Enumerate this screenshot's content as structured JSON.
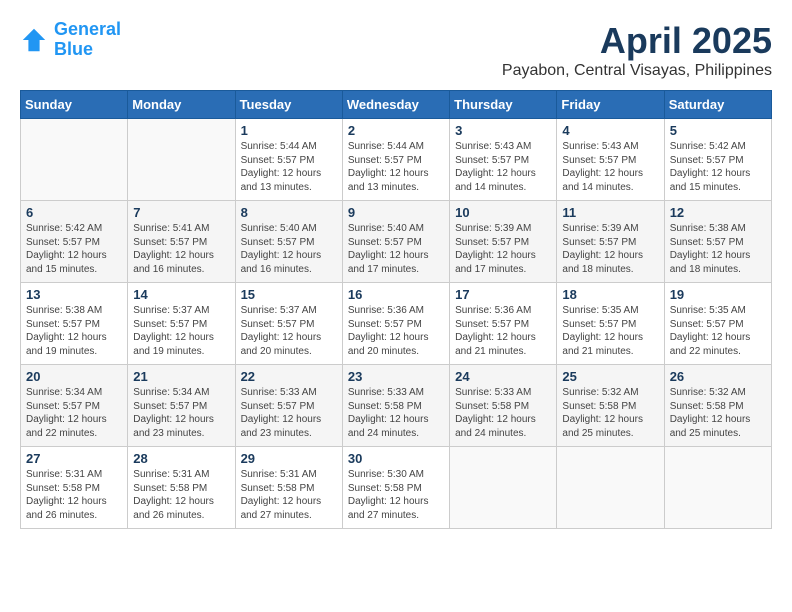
{
  "header": {
    "logo_line1": "General",
    "logo_line2": "Blue",
    "month_year": "April 2025",
    "location": "Payabon, Central Visayas, Philippines"
  },
  "weekdays": [
    "Sunday",
    "Monday",
    "Tuesday",
    "Wednesday",
    "Thursday",
    "Friday",
    "Saturday"
  ],
  "weeks": [
    [
      {
        "day": "",
        "sunrise": "",
        "sunset": "",
        "daylight": ""
      },
      {
        "day": "",
        "sunrise": "",
        "sunset": "",
        "daylight": ""
      },
      {
        "day": "1",
        "sunrise": "Sunrise: 5:44 AM",
        "sunset": "Sunset: 5:57 PM",
        "daylight": "Daylight: 12 hours and 13 minutes."
      },
      {
        "day": "2",
        "sunrise": "Sunrise: 5:44 AM",
        "sunset": "Sunset: 5:57 PM",
        "daylight": "Daylight: 12 hours and 13 minutes."
      },
      {
        "day": "3",
        "sunrise": "Sunrise: 5:43 AM",
        "sunset": "Sunset: 5:57 PM",
        "daylight": "Daylight: 12 hours and 14 minutes."
      },
      {
        "day": "4",
        "sunrise": "Sunrise: 5:43 AM",
        "sunset": "Sunset: 5:57 PM",
        "daylight": "Daylight: 12 hours and 14 minutes."
      },
      {
        "day": "5",
        "sunrise": "Sunrise: 5:42 AM",
        "sunset": "Sunset: 5:57 PM",
        "daylight": "Daylight: 12 hours and 15 minutes."
      }
    ],
    [
      {
        "day": "6",
        "sunrise": "Sunrise: 5:42 AM",
        "sunset": "Sunset: 5:57 PM",
        "daylight": "Daylight: 12 hours and 15 minutes."
      },
      {
        "day": "7",
        "sunrise": "Sunrise: 5:41 AM",
        "sunset": "Sunset: 5:57 PM",
        "daylight": "Daylight: 12 hours and 16 minutes."
      },
      {
        "day": "8",
        "sunrise": "Sunrise: 5:40 AM",
        "sunset": "Sunset: 5:57 PM",
        "daylight": "Daylight: 12 hours and 16 minutes."
      },
      {
        "day": "9",
        "sunrise": "Sunrise: 5:40 AM",
        "sunset": "Sunset: 5:57 PM",
        "daylight": "Daylight: 12 hours and 17 minutes."
      },
      {
        "day": "10",
        "sunrise": "Sunrise: 5:39 AM",
        "sunset": "Sunset: 5:57 PM",
        "daylight": "Daylight: 12 hours and 17 minutes."
      },
      {
        "day": "11",
        "sunrise": "Sunrise: 5:39 AM",
        "sunset": "Sunset: 5:57 PM",
        "daylight": "Daylight: 12 hours and 18 minutes."
      },
      {
        "day": "12",
        "sunrise": "Sunrise: 5:38 AM",
        "sunset": "Sunset: 5:57 PM",
        "daylight": "Daylight: 12 hours and 18 minutes."
      }
    ],
    [
      {
        "day": "13",
        "sunrise": "Sunrise: 5:38 AM",
        "sunset": "Sunset: 5:57 PM",
        "daylight": "Daylight: 12 hours and 19 minutes."
      },
      {
        "day": "14",
        "sunrise": "Sunrise: 5:37 AM",
        "sunset": "Sunset: 5:57 PM",
        "daylight": "Daylight: 12 hours and 19 minutes."
      },
      {
        "day": "15",
        "sunrise": "Sunrise: 5:37 AM",
        "sunset": "Sunset: 5:57 PM",
        "daylight": "Daylight: 12 hours and 20 minutes."
      },
      {
        "day": "16",
        "sunrise": "Sunrise: 5:36 AM",
        "sunset": "Sunset: 5:57 PM",
        "daylight": "Daylight: 12 hours and 20 minutes."
      },
      {
        "day": "17",
        "sunrise": "Sunrise: 5:36 AM",
        "sunset": "Sunset: 5:57 PM",
        "daylight": "Daylight: 12 hours and 21 minutes."
      },
      {
        "day": "18",
        "sunrise": "Sunrise: 5:35 AM",
        "sunset": "Sunset: 5:57 PM",
        "daylight": "Daylight: 12 hours and 21 minutes."
      },
      {
        "day": "19",
        "sunrise": "Sunrise: 5:35 AM",
        "sunset": "Sunset: 5:57 PM",
        "daylight": "Daylight: 12 hours and 22 minutes."
      }
    ],
    [
      {
        "day": "20",
        "sunrise": "Sunrise: 5:34 AM",
        "sunset": "Sunset: 5:57 PM",
        "daylight": "Daylight: 12 hours and 22 minutes."
      },
      {
        "day": "21",
        "sunrise": "Sunrise: 5:34 AM",
        "sunset": "Sunset: 5:57 PM",
        "daylight": "Daylight: 12 hours and 23 minutes."
      },
      {
        "day": "22",
        "sunrise": "Sunrise: 5:33 AM",
        "sunset": "Sunset: 5:57 PM",
        "daylight": "Daylight: 12 hours and 23 minutes."
      },
      {
        "day": "23",
        "sunrise": "Sunrise: 5:33 AM",
        "sunset": "Sunset: 5:58 PM",
        "daylight": "Daylight: 12 hours and 24 minutes."
      },
      {
        "day": "24",
        "sunrise": "Sunrise: 5:33 AM",
        "sunset": "Sunset: 5:58 PM",
        "daylight": "Daylight: 12 hours and 24 minutes."
      },
      {
        "day": "25",
        "sunrise": "Sunrise: 5:32 AM",
        "sunset": "Sunset: 5:58 PM",
        "daylight": "Daylight: 12 hours and 25 minutes."
      },
      {
        "day": "26",
        "sunrise": "Sunrise: 5:32 AM",
        "sunset": "Sunset: 5:58 PM",
        "daylight": "Daylight: 12 hours and 25 minutes."
      }
    ],
    [
      {
        "day": "27",
        "sunrise": "Sunrise: 5:31 AM",
        "sunset": "Sunset: 5:58 PM",
        "daylight": "Daylight: 12 hours and 26 minutes."
      },
      {
        "day": "28",
        "sunrise": "Sunrise: 5:31 AM",
        "sunset": "Sunset: 5:58 PM",
        "daylight": "Daylight: 12 hours and 26 minutes."
      },
      {
        "day": "29",
        "sunrise": "Sunrise: 5:31 AM",
        "sunset": "Sunset: 5:58 PM",
        "daylight": "Daylight: 12 hours and 27 minutes."
      },
      {
        "day": "30",
        "sunrise": "Sunrise: 5:30 AM",
        "sunset": "Sunset: 5:58 PM",
        "daylight": "Daylight: 12 hours and 27 minutes."
      },
      {
        "day": "",
        "sunrise": "",
        "sunset": "",
        "daylight": ""
      },
      {
        "day": "",
        "sunrise": "",
        "sunset": "",
        "daylight": ""
      },
      {
        "day": "",
        "sunrise": "",
        "sunset": "",
        "daylight": ""
      }
    ]
  ]
}
